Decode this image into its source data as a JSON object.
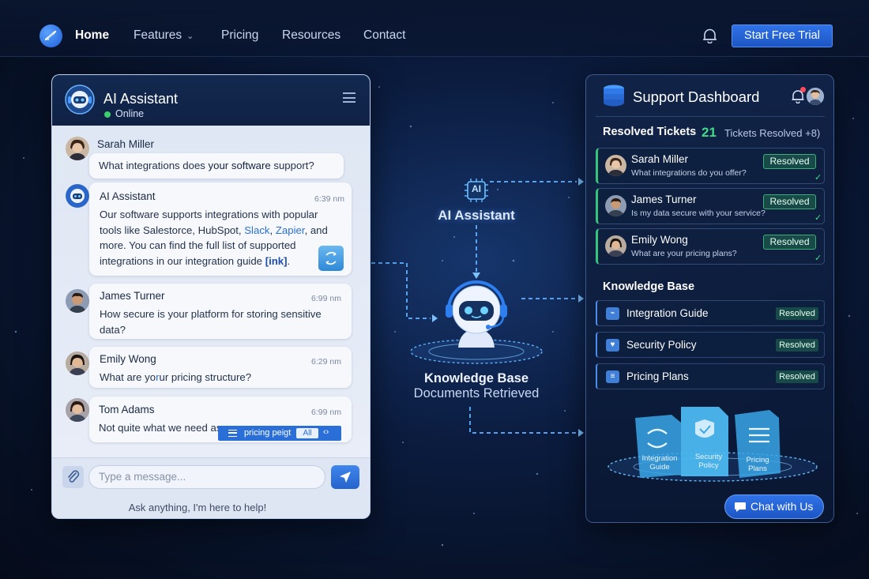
{
  "nav": {
    "items": [
      {
        "label": "Home",
        "active": true
      },
      {
        "label": "Features",
        "has_dropdown": true
      },
      {
        "label": "Pricing"
      },
      {
        "label": "Resources"
      },
      {
        "label": "Contact"
      }
    ],
    "cta_label": "Start Free Trial",
    "icons": {
      "logo": "logo-icon",
      "bell": "bell-icon"
    }
  },
  "chat": {
    "title": "AI Assistant",
    "status": "Online",
    "messages": [
      {
        "author": "Sarah Miller",
        "time": "",
        "text_parts": [
          "What integrations does ",
          "your software",
          " support?"
        ]
      },
      {
        "author": "AI Assistant",
        "time": "6:39 nm",
        "line1": "Our software supports integrations with popular",
        "line2_a": "tools like Salestorce, HubSpot, ",
        "line2_b": "Slack",
        "line2_c": ", ",
        "line2_d": "Zapier",
        "line2_e": ", and",
        "line3": "more. You can find the full list of supported",
        "line4_a": "integrations in our integration guide ",
        "line4_b": "[ink]",
        "line4_c": "."
      },
      {
        "author": "James Turner",
        "time": "6:99 nm",
        "line1": "How secure is your platform for storing sensitive",
        "line2": "data?"
      },
      {
        "author": "Emily Wong",
        "time": "6:29 nm",
        "text_a": "What are yo",
        "text_b": "r",
        "text_c": "ur pricing structure?"
      },
      {
        "author": "Tom Adams",
        "time": "6:99 nm",
        "text": "Not quite what we need as"
      }
    ],
    "suggestion": {
      "label": "pricing peigt",
      "all": "All",
      "arrow": "‹›"
    },
    "input_placeholder": "Type a message...",
    "hint": "Ask anything, I'm here to help!"
  },
  "center": {
    "chip_label": "AI",
    "ai_label": "AI Assistant",
    "kb_title": "Knowledge Base",
    "kb_sub": "Documents Retrieved"
  },
  "dashboard": {
    "title": "Support Dashboard",
    "resolved_label": "Resolved Tickets",
    "resolved_count": "21",
    "resolved_sub": "Tickets Resolved +8)",
    "tickets": [
      {
        "name": "Sarah Miller",
        "question": "What integrations do you offer?",
        "status": "Resolved"
      },
      {
        "name": "James Turner",
        "question": "Is my data secure with your service?",
        "status": "Resolved"
      },
      {
        "name": "Emily Wong",
        "question": "What are your pricing plans?",
        "status": "Resolved"
      }
    ],
    "kb_label": "Knowledge Base",
    "kb_items": [
      {
        "name": "Integration Guide",
        "status": "Resolved",
        "icon": "link-icon"
      },
      {
        "name": "Security Policy",
        "status": "Resolved",
        "icon": "shield-icon"
      },
      {
        "name": "Pricing Plans",
        "status": "Resolved",
        "icon": "list-icon"
      }
    ],
    "docs": [
      {
        "line1": "Integration",
        "line2": "Guide"
      },
      {
        "line1": "Security",
        "line2": "Policy"
      },
      {
        "line1": "Pricing",
        "line2": "Plans"
      }
    ],
    "chat_button": "Chat with Us"
  },
  "colors": {
    "accent": "#2f72e8",
    "success": "#3fdc8a",
    "background": "#0b1c3f"
  }
}
